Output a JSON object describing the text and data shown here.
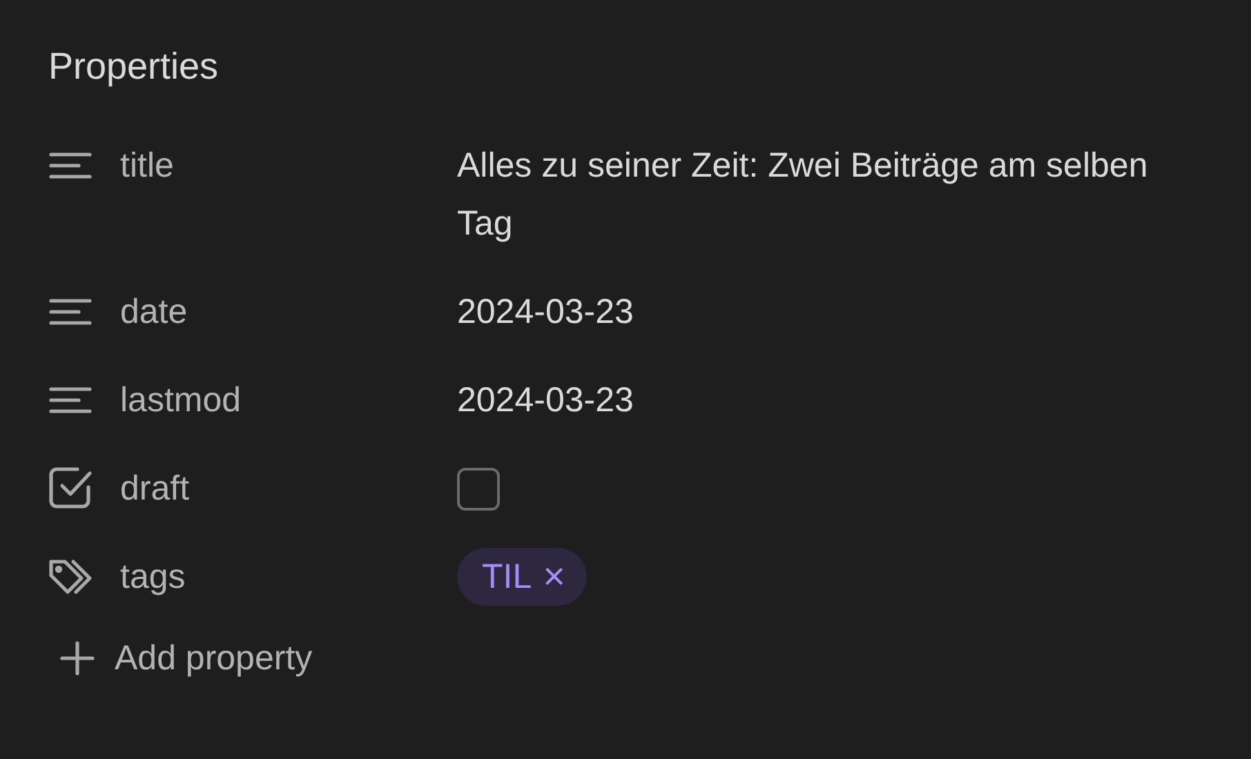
{
  "heading": "Properties",
  "properties": [
    {
      "kind": "text",
      "name": "title",
      "value": "Alles zu seiner Zeit: Zwei Beiträge am selben Tag"
    },
    {
      "kind": "text",
      "name": "date",
      "value": "2024-03-23"
    },
    {
      "kind": "text",
      "name": "lastmod",
      "value": "2024-03-23"
    },
    {
      "kind": "checkbox",
      "name": "draft",
      "checked": false
    },
    {
      "kind": "tags",
      "name": "tags",
      "tags": [
        {
          "label": "TIL",
          "remove": "×"
        }
      ]
    }
  ],
  "add_button": "Add property"
}
